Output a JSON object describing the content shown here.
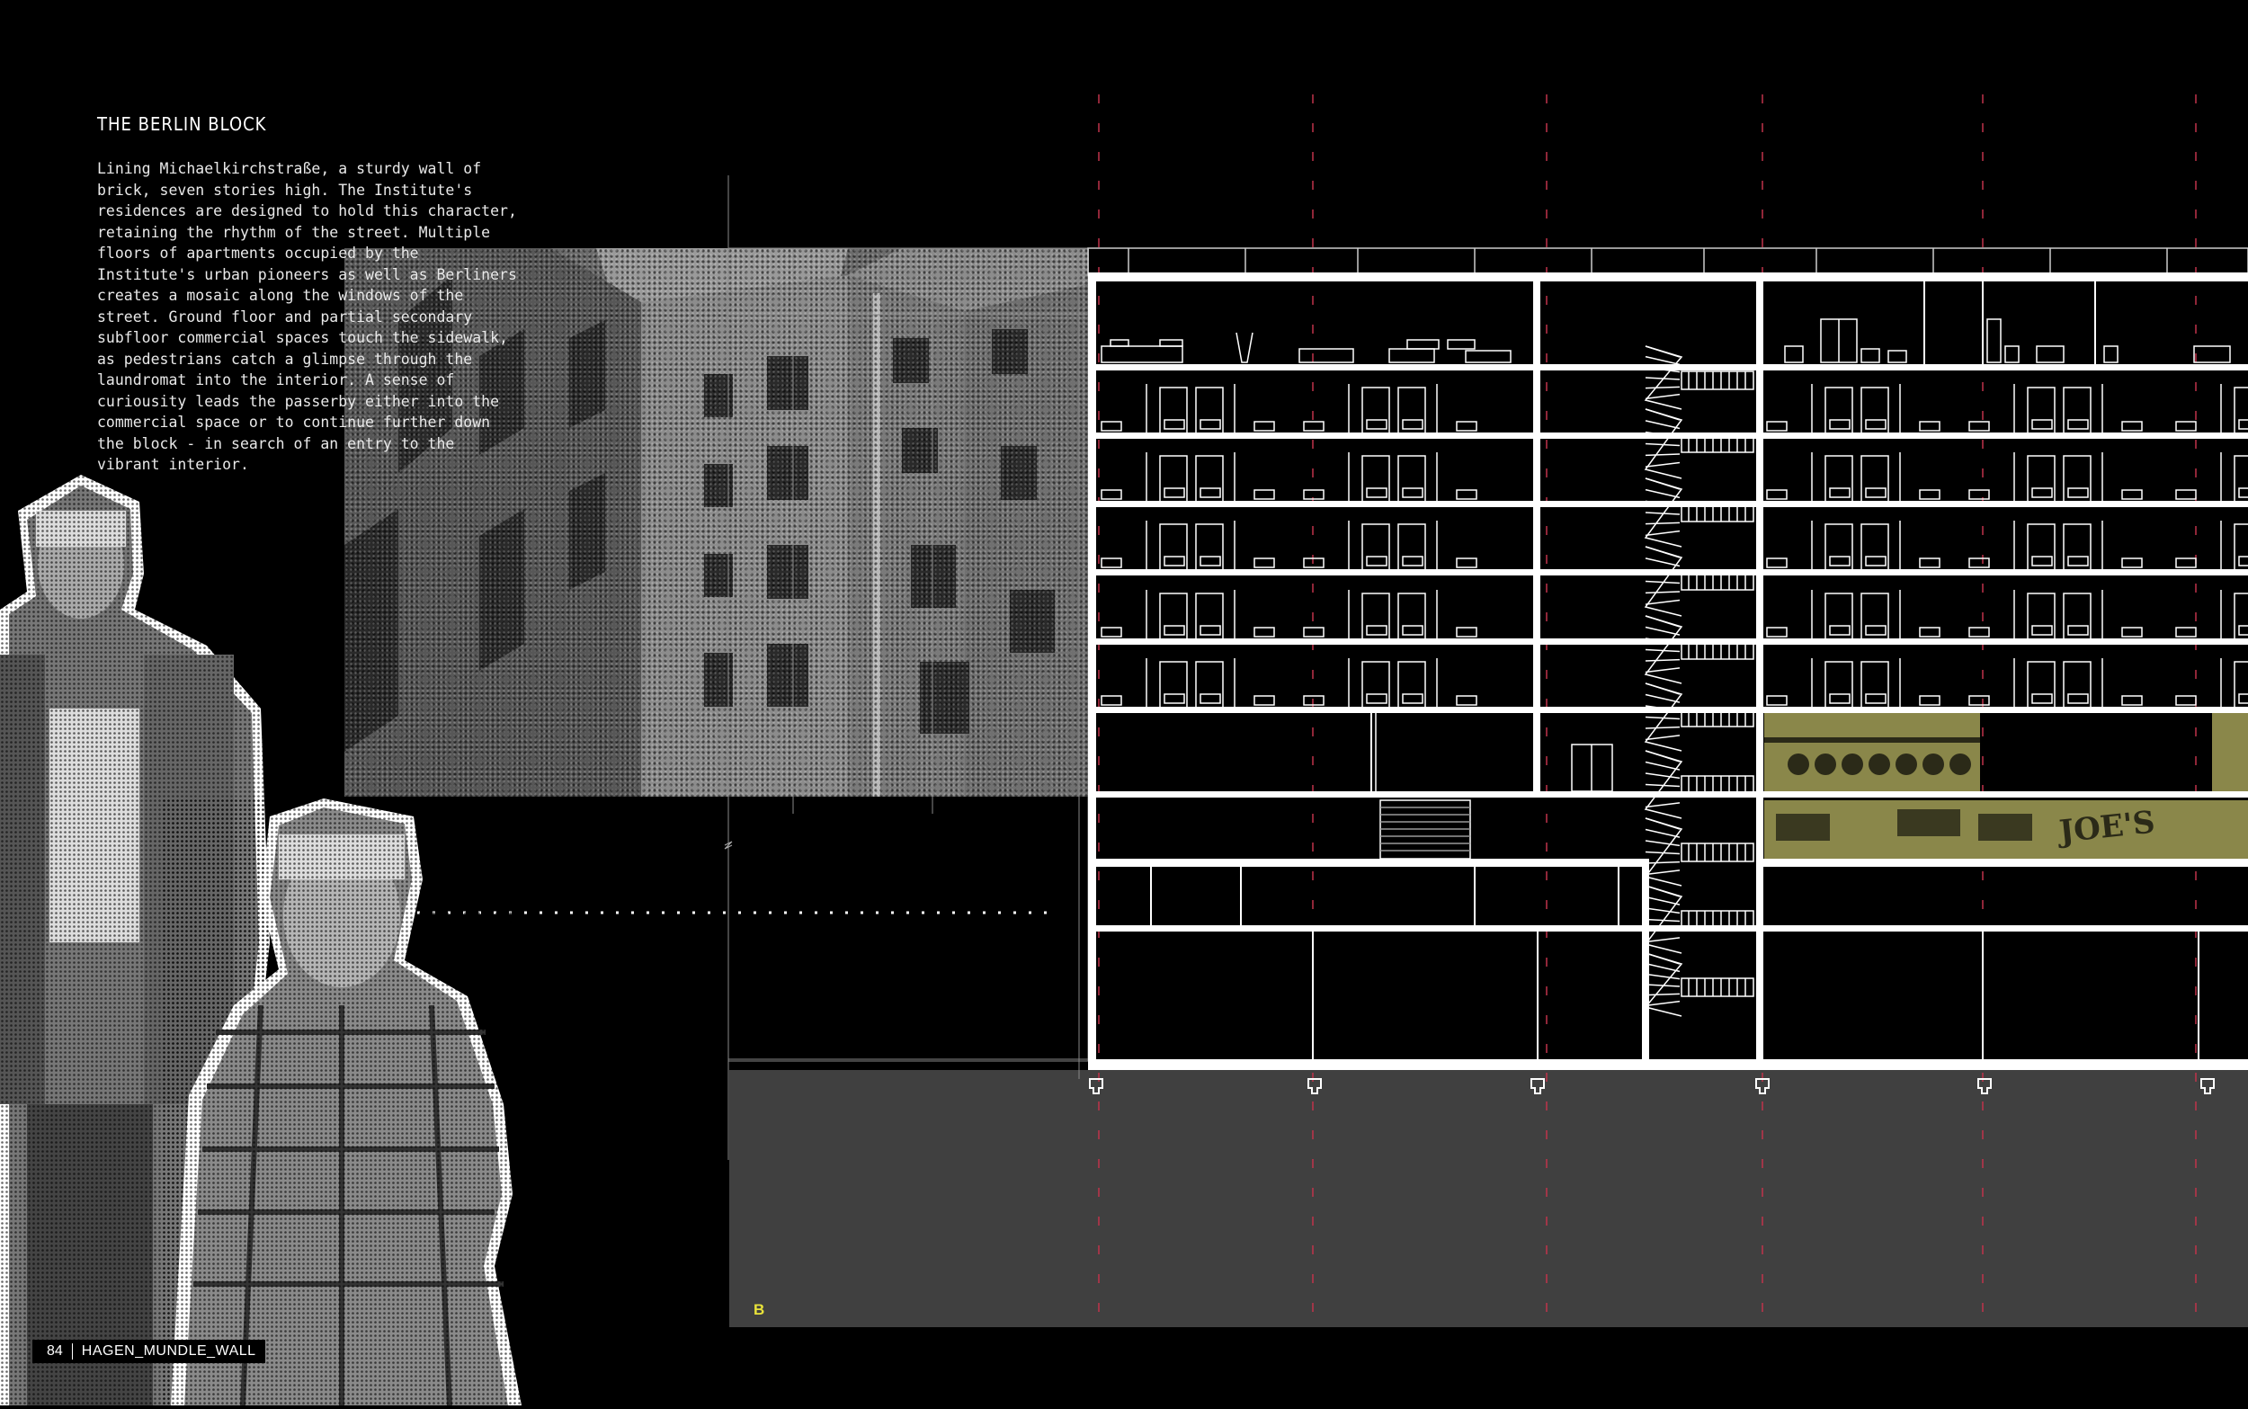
{
  "article": {
    "title": "THE BERLIN BLOCK",
    "body": "Lining Michaelkirchstraße, a sturdy wall of brick, seven stories high. The Institute's residences are designed to hold this character, retaining the rhythm of the street. Multiple floors of apartments occupied by the Institute's urban pioneers as well as Berliners creates a mosaic along the windows of the street. Ground floor and partial secondary subfloor commercial spaces touch the sidewalk, as pedestrians catch a glimpse through the laundromat into the interior. A sense of curiousity leads the passerby either into the commercial space or to continue further down the block - in search of an entry to the vibrant interior."
  },
  "drawing": {
    "section_label": "B",
    "sign_text": "JOE'S",
    "colors": {
      "background": "#000000",
      "ground": "#404040",
      "grid_line": "#c0334a",
      "accent_yellow": "#e8e23a",
      "photo_tint": "#8a874a"
    }
  },
  "footer": {
    "page_number": "84",
    "book_title": "HAGEN_MUNDLE_WALL"
  }
}
